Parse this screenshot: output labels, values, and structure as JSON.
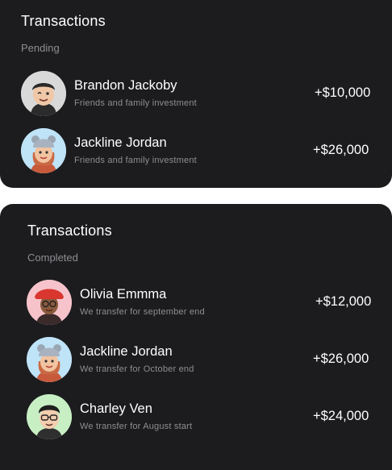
{
  "pending": {
    "title": "Transactions",
    "subtitle": "Pending",
    "items": [
      {
        "name": "Brandon Jackoby",
        "description": "Friends and family investment",
        "amount": "+$10,000",
        "avatar_icon": "man-wink-avatar-icon",
        "avatar_bg": "#d9d9d9"
      },
      {
        "name": "Jackline Jordan",
        "description": "Friends and family investment",
        "amount": "+$26,000",
        "avatar_icon": "woman-bear-hat-avatar-icon",
        "avatar_bg": "#bfe3f7"
      }
    ]
  },
  "completed": {
    "title": "Transactions",
    "subtitle": "Completed",
    "items": [
      {
        "name": "Olivia Emmma",
        "description": "We transfer for september end",
        "amount": "+$12,000",
        "avatar_icon": "woman-red-hat-avatar-icon",
        "avatar_bg": "#f7c3cb"
      },
      {
        "name": "Jackline Jordan",
        "description": "We transfer for October end",
        "amount": "+$26,000",
        "avatar_icon": "woman-bear-hat-avatar-icon",
        "avatar_bg": "#bfe3f7"
      },
      {
        "name": "Charley Ven",
        "description": "We transfer for August start",
        "amount": "+$24,000",
        "avatar_icon": "man-glasses-avatar-icon",
        "avatar_bg": "#c8efc4"
      }
    ]
  },
  "colors": {
    "card_bg": "#1c1c1e",
    "text": "#ffffff",
    "muted": "#8e8e93"
  }
}
